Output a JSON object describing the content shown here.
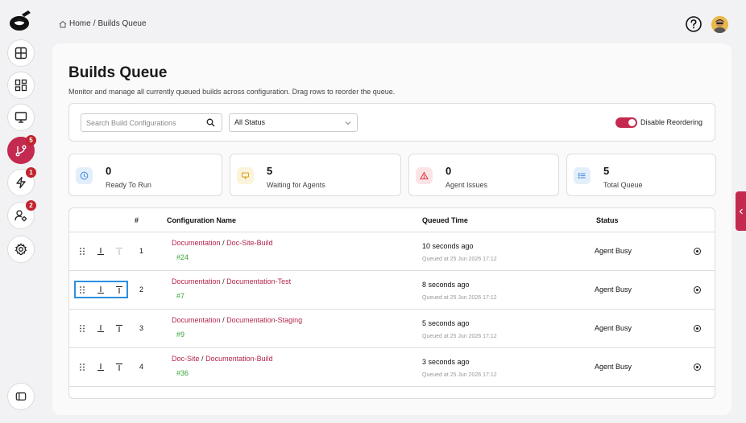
{
  "breadcrumb": {
    "home": "Home",
    "separator": "/",
    "current": "Builds Queue"
  },
  "sidebar": {
    "items": [
      {
        "name": "overview",
        "icon": "layout-icon",
        "badge": ""
      },
      {
        "name": "dashboard",
        "icon": "grid-icon",
        "badge": ""
      },
      {
        "name": "agents",
        "icon": "monitor-icon",
        "badge": ""
      },
      {
        "name": "builds-queue",
        "icon": "git-branch-icon",
        "badge": "5",
        "active": true
      },
      {
        "name": "actions",
        "icon": "lightning-icon",
        "badge": "1"
      },
      {
        "name": "users",
        "icon": "user-gear-icon",
        "badge": "2"
      },
      {
        "name": "settings",
        "icon": "gear-icon",
        "badge": ""
      }
    ]
  },
  "page": {
    "title": "Builds Queue",
    "subtitle": "Monitor and manage all currently queued builds across configuration. Drag rows to reorder the queue."
  },
  "filters": {
    "search_placeholder": "Search Build Configurations",
    "status_selected": "All Status",
    "toggle_label": "Disable Reordering",
    "toggle_on": true
  },
  "stats": [
    {
      "value": "0",
      "label": "Ready To Run",
      "icon": "clock-icon",
      "color": "#4a8fe0",
      "bg": "#e3eefb"
    },
    {
      "value": "5",
      "label": "Waiting for Agents",
      "icon": "chat-icon",
      "color": "#d9a520",
      "bg": "#fbf3dc"
    },
    {
      "value": "0",
      "label": "Agent Issues",
      "icon": "warning-icon",
      "color": "#d9414e",
      "bg": "#fbe4e6"
    },
    {
      "value": "5",
      "label": "Total Queue",
      "icon": "list-icon",
      "color": "#4a8fe0",
      "bg": "#e3eefb"
    }
  ],
  "table": {
    "headers": {
      "num": "#",
      "config": "Configuration Name",
      "queued": "Queued Time",
      "status": "Status"
    },
    "rows": [
      {
        "num": "1",
        "project": "Documentation",
        "sep": "/",
        "config": "Doc-Site-Build",
        "build": "#24",
        "queued": "10 seconds ago",
        "queued_at": "Queued at 25 Jun 2026 17:12",
        "status": "Agent Busy"
      },
      {
        "num": "2",
        "project": "Documentation",
        "sep": "/",
        "config": "Documentation-Test",
        "build": "#7",
        "queued": "8 seconds ago",
        "queued_at": "Queued at 25 Jun 2026 17:12",
        "status": "Agent Busy"
      },
      {
        "num": "3",
        "project": "Documentation",
        "sep": "/",
        "config": "Documentation-Staging",
        "build": "#9",
        "queued": "5 seconds ago",
        "queued_at": "Queued at 25 Jun 2026 17:12",
        "status": "Agent Busy"
      },
      {
        "num": "4",
        "project": "Doc-Site",
        "sep": "/",
        "config": "Documentation-Build",
        "build": "#36",
        "queued": "3 seconds ago",
        "queued_at": "Queued at 25 Jun 2026 17:12",
        "status": "Agent Busy"
      }
    ]
  },
  "colors": {
    "accent": "#c42a50",
    "build_green": "#3aa33a",
    "focus": "#2a8fe0"
  }
}
